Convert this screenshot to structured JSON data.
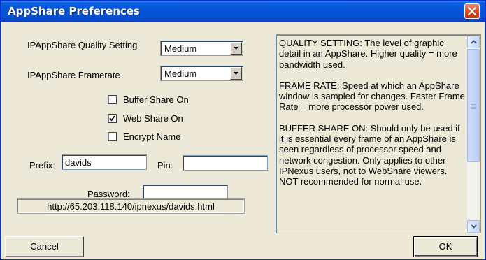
{
  "window": {
    "title": "AppShare Preferences"
  },
  "settings": {
    "quality_label": "IPAppShare Quality Setting",
    "quality_value": "Medium",
    "framerate_label": "IPAppShare Framerate",
    "framerate_value": "Medium",
    "buffer_share": {
      "label": "Buffer Share On",
      "checked": false
    },
    "web_share": {
      "label": "Web Share On",
      "checked": true
    },
    "encrypt_name": {
      "label": "Encrypt Name",
      "checked": false
    },
    "prefix_label": "Prefix:",
    "prefix_value": "davids",
    "pin_label": "Pin:",
    "pin_value": "",
    "password_label": "Password:",
    "password_value": "",
    "url": "http://65.203.118.140/ipnexus/davids.html"
  },
  "help": {
    "paragraphs": [
      "QUALITY SETTING: The level of graphic detail in an AppShare. Higher quality = more bandwidth used.",
      "FRAME RATE: Speed at which an AppShare window is sampled for changes. Faster Frame Rate = more processor power used.",
      "BUFFER SHARE ON: Should only be used if it is essential every frame of an AppShare is seen regardless of processor speed and network congestion. Only applies to other IPNexus users, not to WebShare viewers. NOT recommended for normal use."
    ]
  },
  "buttons": {
    "cancel": "Cancel",
    "ok": "OK"
  },
  "icons": {
    "close": "close-icon",
    "dropdown": "chevron-down-icon",
    "check": "checkmark-icon",
    "scroll_up": "chevron-up-icon",
    "scroll_down": "chevron-down-icon"
  },
  "colors": {
    "titlebar": "#0553d6",
    "close_button": "#d6451b",
    "dialog_bg": "#ece9d8"
  }
}
